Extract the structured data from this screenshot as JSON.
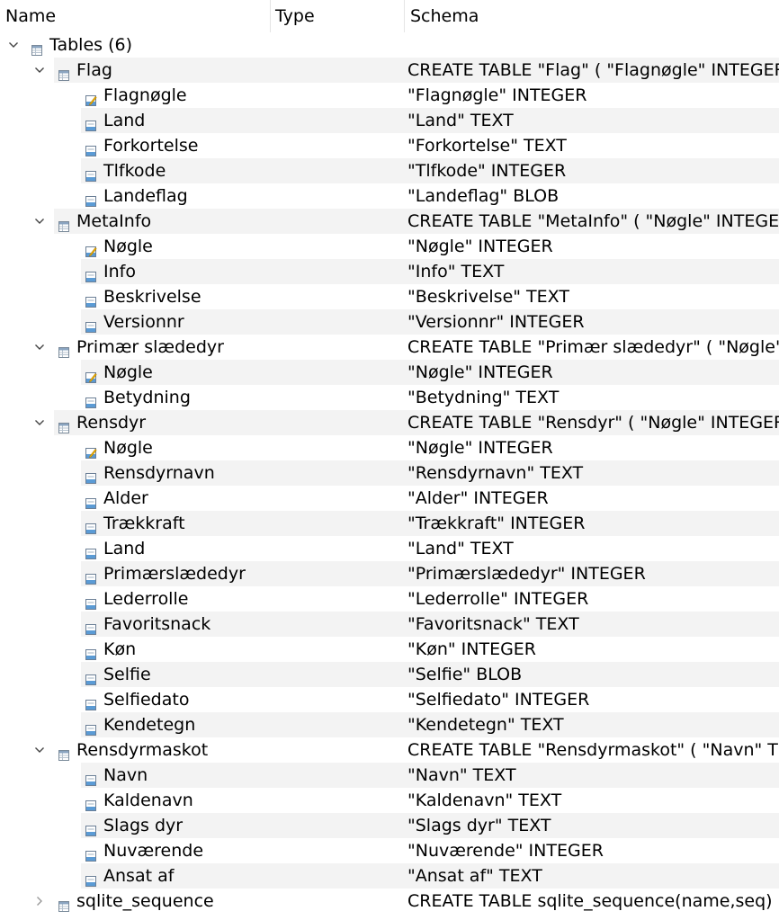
{
  "header": {
    "name": "Name",
    "type": "Type",
    "schema": "Schema"
  },
  "root": {
    "label": "Tables (6)"
  },
  "tables": [
    {
      "name": "Flag",
      "expanded": true,
      "schema": "CREATE TABLE \"Flag\" ( \"Flagnøgle\" INTEGER, \"",
      "fields": [
        {
          "name": "Flagnøgle",
          "type": "INTEGER",
          "schema": "\"Flagnøgle\" INTEGER",
          "key": true
        },
        {
          "name": "Land",
          "type": "TEXT",
          "schema": "\"Land\" TEXT",
          "key": false
        },
        {
          "name": "Forkortelse",
          "type": "TEXT",
          "schema": "\"Forkortelse\" TEXT",
          "key": false
        },
        {
          "name": "Tlfkode",
          "type": "INTEGER",
          "schema": "\"Tlfkode\" INTEGER",
          "key": false
        },
        {
          "name": "Landeflag",
          "type": "BLOB",
          "schema": "\"Landeflag\" BLOB",
          "key": false
        }
      ]
    },
    {
      "name": "MetaInfo",
      "expanded": true,
      "schema": "CREATE TABLE \"MetaInfo\" ( \"Nøgle\" INTEGER,",
      "fields": [
        {
          "name": "Nøgle",
          "type": "INTEGER",
          "schema": "\"Nøgle\" INTEGER",
          "key": true
        },
        {
          "name": "Info",
          "type": "TEXT",
          "schema": "\"Info\" TEXT",
          "key": false
        },
        {
          "name": "Beskrivelse",
          "type": "TEXT",
          "schema": "\"Beskrivelse\" TEXT",
          "key": false
        },
        {
          "name": "Versionnr",
          "type": "INTEGER",
          "schema": "\"Versionnr\" INTEGER",
          "key": false
        }
      ]
    },
    {
      "name": "Primær slædedyr",
      "expanded": true,
      "schema": "CREATE TABLE \"Primær slædedyr\" ( \"Nøgle\" IN",
      "fields": [
        {
          "name": "Nøgle",
          "type": "INTEGER",
          "schema": "\"Nøgle\" INTEGER",
          "key": true
        },
        {
          "name": "Betydning",
          "type": "TEXT",
          "schema": "\"Betydning\" TEXT",
          "key": false
        }
      ]
    },
    {
      "name": "Rensdyr",
      "expanded": true,
      "schema": "CREATE TABLE \"Rensdyr\" ( \"Nøgle\" INTEGER, \"",
      "fields": [
        {
          "name": "Nøgle",
          "type": "INTEGER",
          "schema": "\"Nøgle\" INTEGER",
          "key": true
        },
        {
          "name": "Rensdyrnavn",
          "type": "TEXT",
          "schema": "\"Rensdyrnavn\" TEXT",
          "key": false
        },
        {
          "name": "Alder",
          "type": "INTEGER",
          "schema": "\"Alder\" INTEGER",
          "key": false
        },
        {
          "name": "Trækkraft",
          "type": "INTEGER",
          "schema": "\"Trækkraft\" INTEGER",
          "key": false
        },
        {
          "name": "Land",
          "type": "TEXT",
          "schema": "\"Land\" TEXT",
          "key": false
        },
        {
          "name": "Primærslædedyr",
          "type": "INTEGER",
          "schema": "\"Primærslædedyr\" INTEGER",
          "key": false
        },
        {
          "name": "Lederrolle",
          "type": "INTEGER",
          "schema": "\"Lederrolle\" INTEGER",
          "key": false
        },
        {
          "name": "Favoritsnack",
          "type": "TEXT",
          "schema": "\"Favoritsnack\" TEXT",
          "key": false
        },
        {
          "name": "Køn",
          "type": "INTEGER",
          "schema": "\"Køn\" INTEGER",
          "key": false
        },
        {
          "name": "Selfie",
          "type": "BLOB",
          "schema": "\"Selfie\" BLOB",
          "key": false
        },
        {
          "name": "Selfiedato",
          "type": "INTEGER",
          "schema": "\"Selfiedato\" INTEGER",
          "key": false
        },
        {
          "name": "Kendetegn",
          "type": "TEXT",
          "schema": "\"Kendetegn\" TEXT",
          "key": false
        }
      ]
    },
    {
      "name": "Rensdyrmaskot",
      "expanded": true,
      "schema": "CREATE TABLE \"Rensdyrmaskot\" ( \"Navn\" TEX",
      "fields": [
        {
          "name": "Navn",
          "type": "TEXT",
          "schema": "\"Navn\" TEXT",
          "key": false
        },
        {
          "name": "Kaldenavn",
          "type": "TEXT",
          "schema": "\"Kaldenavn\" TEXT",
          "key": false
        },
        {
          "name": "Slags dyr",
          "type": "TEXT",
          "schema": "\"Slags dyr\" TEXT",
          "key": false
        },
        {
          "name": "Nuværende",
          "type": "INTEGER",
          "schema": "\"Nuværende\" INTEGER",
          "key": false
        },
        {
          "name": "Ansat af",
          "type": "TEXT",
          "schema": "\"Ansat af\" TEXT",
          "key": false
        }
      ]
    },
    {
      "name": "sqlite_sequence",
      "expanded": false,
      "schema": "CREATE TABLE sqlite_sequence(name,seq)",
      "fields": []
    }
  ]
}
